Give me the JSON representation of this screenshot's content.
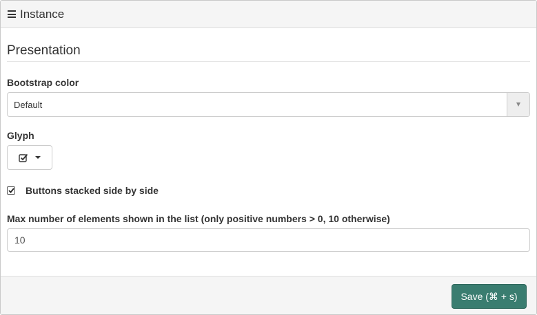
{
  "header": {
    "title": "Instance",
    "icon": "hamburger-icon"
  },
  "section": {
    "title": "Presentation"
  },
  "bootstrap_color": {
    "label": "Bootstrap color",
    "selected": "Default"
  },
  "glyph": {
    "label": "Glyph",
    "icon": "check-square-icon"
  },
  "stacked": {
    "label": "Buttons stacked side by side",
    "checked": true
  },
  "max_elements": {
    "label": "Max number of elements shown in the list (only positive numbers > 0, 10 otherwise)",
    "value": "10"
  },
  "footer": {
    "save_label": "Save  (⌘ + s)"
  },
  "colors": {
    "accent": "#3a7d70"
  }
}
